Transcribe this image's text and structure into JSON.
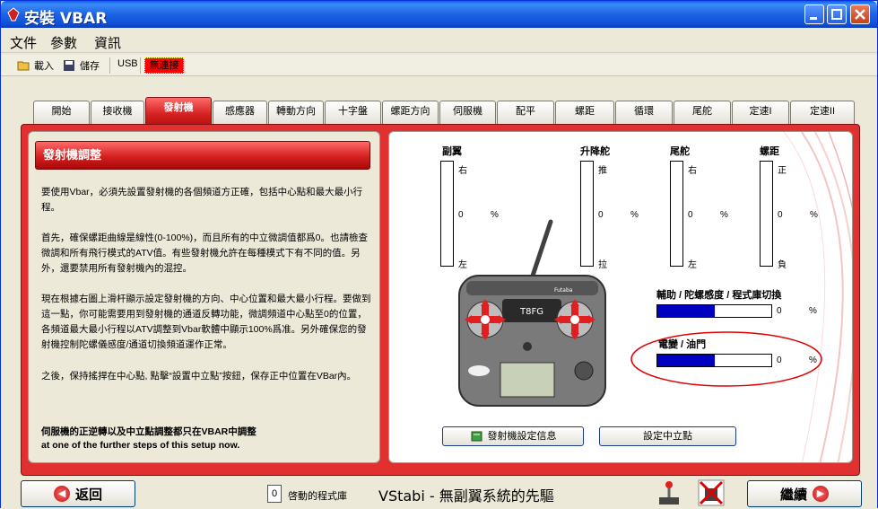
{
  "window": {
    "title": "安裝 VBAR"
  },
  "menu": {
    "items": [
      "文件",
      "參數",
      "資訊"
    ]
  },
  "toolbar": {
    "load": "載入",
    "save": "儲存",
    "usb_label": "USB",
    "usb_status": "無連接"
  },
  "tabs": [
    {
      "label": "開始"
    },
    {
      "label": "接收機"
    },
    {
      "label": "發射機"
    },
    {
      "label": "感應器"
    },
    {
      "label": "轉動方向"
    },
    {
      "label": "十字盤"
    },
    {
      "label": "螺距方向"
    },
    {
      "label": "伺服機"
    },
    {
      "label": "配平"
    },
    {
      "label": "螺距"
    },
    {
      "label": "循環"
    },
    {
      "label": "尾舵"
    },
    {
      "label": "定速I"
    },
    {
      "label": "定速II"
    }
  ],
  "active_tab": 2,
  "left": {
    "heading": "發射機調整",
    "paragraphs": [
      "要使用Vbar，必須先設置發射機的各個頻道方正確，包括中心點和最大最小行程。",
      "首先，確保螺距曲線是線性(0-100%)，而且所有的中立微調值都爲0。也請檢查微調和所有飛行模式的ATV值。有些發射機允許在每種模式下有不同的值。另外，還要禁用所有發射機內的混控。",
      "現在根據右圖上滑杆顯示設定發射機的方向、中心位置和最大最小行程。要做到這一點，你可能需要用到發射機的通道反轉功能，微調頻道中心點至0的位置，各頻道最大最小行程以ATV調整到Vbar軟體中顯示100%爲准。另外確保您的發射機控制陀螺儀感度/通道切換頻道運作正常。",
      "之後，保持搖捍在中心點, 點擊“設置中立點”按鈕，保存正中位置在VBar內。"
    ],
    "note_bold": "伺服機的正逆轉以及中立點調整都只在VBAR中調整",
    "note_en": "at one of the further steps of this setup now."
  },
  "channels": [
    {
      "name": "副翼",
      "top": "右",
      "mid": "0",
      "bottom": "左",
      "unit": "%"
    },
    {
      "name": "升降舵",
      "top": "推",
      "mid": "0",
      "bottom": "拉",
      "unit": "%"
    },
    {
      "name": "尾舵",
      "top": "右",
      "mid": "0",
      "bottom": "左",
      "unit": "%"
    },
    {
      "name": "螺距",
      "top": "正",
      "mid": "0",
      "bottom": "負",
      "unit": "%"
    }
  ],
  "gyro": {
    "label": "輔助 / 陀螺感度 / 程式庫切換",
    "value": "0",
    "unit": "%",
    "fill_fraction": 0.5
  },
  "throttle": {
    "label": "電變 / 油門",
    "value": "0",
    "unit": "%",
    "fill_fraction": 0.5
  },
  "transmitter": {
    "model": "T8FG",
    "brand": "Futaba"
  },
  "buttons": {
    "tx_info": "發射機設定信息",
    "set_center": "設定中立點"
  },
  "bottom": {
    "back": "返回",
    "next": "繼續",
    "bank_num": "0",
    "bank_label": "啓動的程式庫",
    "slogan": "VStabi - 無副翼系統的先驅"
  },
  "colors": {
    "accent_red": "#e03030",
    "bar_blue": "#0000c0",
    "status_red": "#ff0000"
  }
}
